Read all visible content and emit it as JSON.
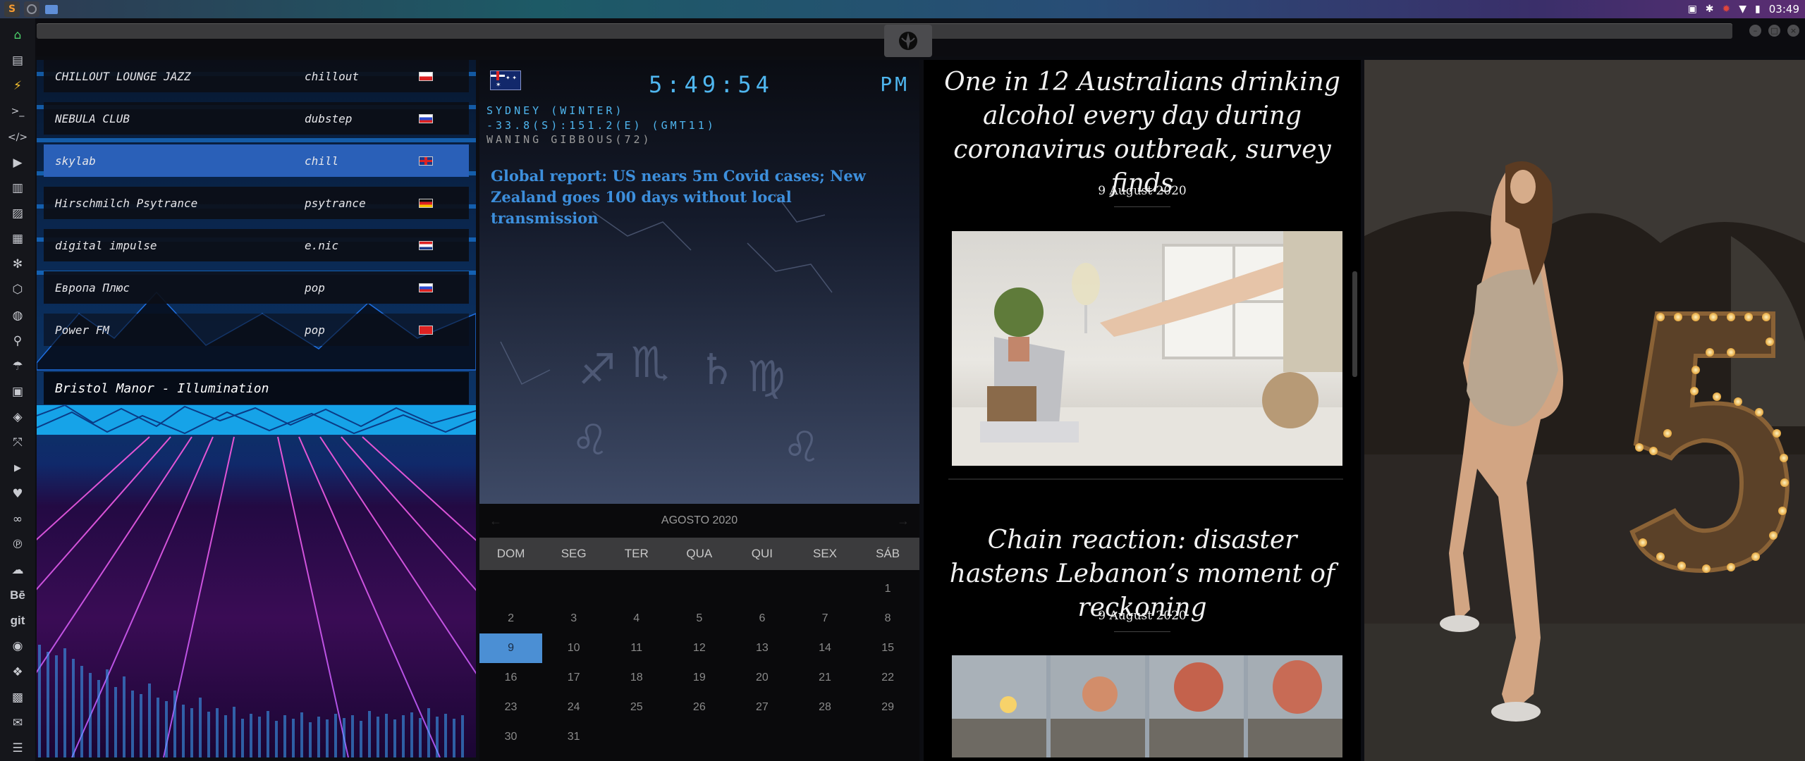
{
  "topbar": {
    "tray_time": "03:49"
  },
  "dock": {
    "icons": [
      "home-icon",
      "file-icon",
      "bolt-icon",
      "terminal-icon",
      "code-icon",
      "play-icon",
      "files-icon",
      "image-icon",
      "newspaper-icon",
      "settings-icon",
      "hexagon-icon",
      "globe-icon",
      "search-icon",
      "umbrella-icon",
      "contact-icon",
      "tags-icon",
      "expand-icon",
      "youtube-icon",
      "heart-icon",
      "infinity-icon",
      "pinterest-icon",
      "cloud-icon",
      "behance-icon",
      "git-icon",
      "github-icon",
      "cubes-icon",
      "map-icon",
      "mail-icon",
      "server-icon"
    ],
    "behance_label": "Bē",
    "git_label": "git"
  },
  "radio": {
    "stations": [
      {
        "name": "CHILLOUT LOUNGE JAZZ",
        "genre": "chillout",
        "flag": "poland"
      },
      {
        "name": "NEBULA CLUB",
        "genre": "dubstep",
        "flag": "russia"
      },
      {
        "name": "skylab",
        "genre": "chill",
        "flag": "uk"
      },
      {
        "name": "Hirschmilch Psytrance",
        "genre": "psytrance",
        "flag": "germany"
      },
      {
        "name": "digital impulse",
        "genre": "e.nic",
        "flag": "croatia"
      },
      {
        "name": "Европа Плюс",
        "genre": "pop",
        "flag": "russia"
      },
      {
        "name": "Power FM",
        "genre": "pop",
        "flag": "turkey"
      }
    ],
    "now_playing": "Bristol Manor - Illumination"
  },
  "astro": {
    "time": "5:49:54",
    "ampm": "PM",
    "location": "SYDNEY (WINTER)",
    "coords": "-33.8(S):151.2(E) (GMT11)",
    "moon": "WANING GIBBOUS(72)",
    "headline": "Global report: US nears 5m Covid cases; New Zealand goes 100 days without local transmission"
  },
  "calendar": {
    "month": "AGOSTO 2020",
    "weekdays": [
      "DOM",
      "SEG",
      "TER",
      "QUA",
      "QUI",
      "SEX",
      "SÁB"
    ],
    "weeks": [
      [
        "",
        "",
        "",
        "",
        "",
        "",
        "1"
      ],
      [
        "2",
        "3",
        "4",
        "5",
        "6",
        "7",
        "8"
      ],
      [
        "9",
        "10",
        "11",
        "12",
        "13",
        "14",
        "15"
      ],
      [
        "16",
        "17",
        "18",
        "19",
        "20",
        "21",
        "22"
      ],
      [
        "23",
        "24",
        "25",
        "26",
        "27",
        "28",
        "29"
      ],
      [
        "30",
        "31",
        "",
        "",
        "",
        "",
        ""
      ]
    ],
    "today": "9"
  },
  "news": {
    "articles": [
      {
        "title": "One in 12 Australians drinking alcohol every day during coronavirus outbreak, survey finds",
        "date": "9 August 2020"
      },
      {
        "title": "Chain reaction: disaster hastens Lebanon’s moment of reckoning",
        "date": "9 August 2020"
      }
    ]
  },
  "colors": {
    "accent_blue": "#4fb6ef",
    "selected_station": "#2a60b8",
    "headline_blue": "#3d8fdc",
    "today": "#4b8fd4"
  }
}
